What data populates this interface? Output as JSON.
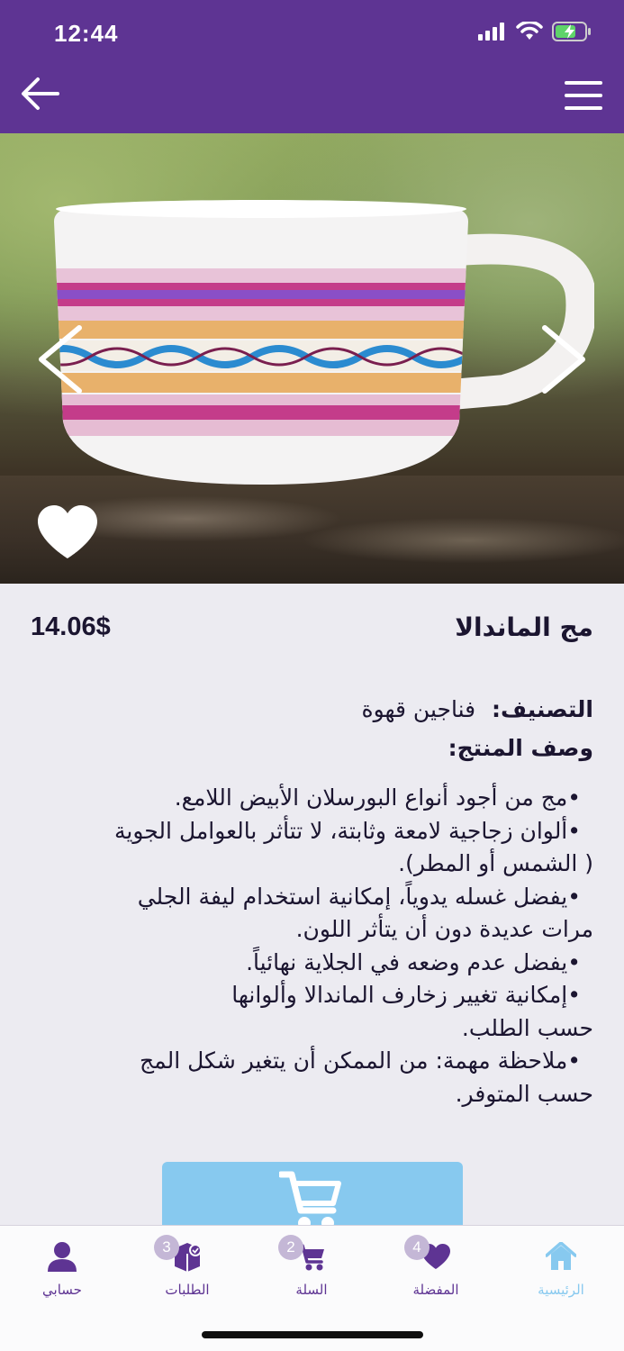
{
  "status": {
    "time": "12:44"
  },
  "product": {
    "name": "مج الماندالا",
    "price": "14.06$",
    "category_label": "التصنيف:",
    "category_value": "فناجين قهوة",
    "description_title": "وصف المنتج:",
    "description_lines": [
      "•مج من أجود أنواع البورسلان الأبيض اللامع.",
      "•ألوان زجاجية لامعة وثابتة، لا تتأثر بالعوامل الجوية",
      "( الشمس أو المطر).",
      "•يفضل غسله يدوياً، إمكانية استخدام ليفة الجلي",
      "مرات عديدة دون أن يتأثر اللون.",
      "•يفضل عدم وضعه في الجلاية نهائياً.",
      "•إمكانية تغيير زخارف الماندالا وألوانها",
      "حسب الطلب.",
      "•ملاحظة مهمة: من الممكن أن يتغير شكل المج",
      "حسب المتوفر."
    ]
  },
  "tabs": [
    {
      "label": "حسابي",
      "icon": "person-icon"
    },
    {
      "label": "الطلبات",
      "icon": "orders-box-icon",
      "badge": "3"
    },
    {
      "label": "السلة",
      "icon": "cart-icon",
      "badge": "2"
    },
    {
      "label": "المفضلة",
      "icon": "heart-icon",
      "badge": "4"
    },
    {
      "label": "الرئيسية",
      "icon": "home-icon",
      "active": true
    }
  ],
  "colors": {
    "brand": "#5e3493",
    "accent": "#87c9ef",
    "background": "#ecebf1"
  }
}
